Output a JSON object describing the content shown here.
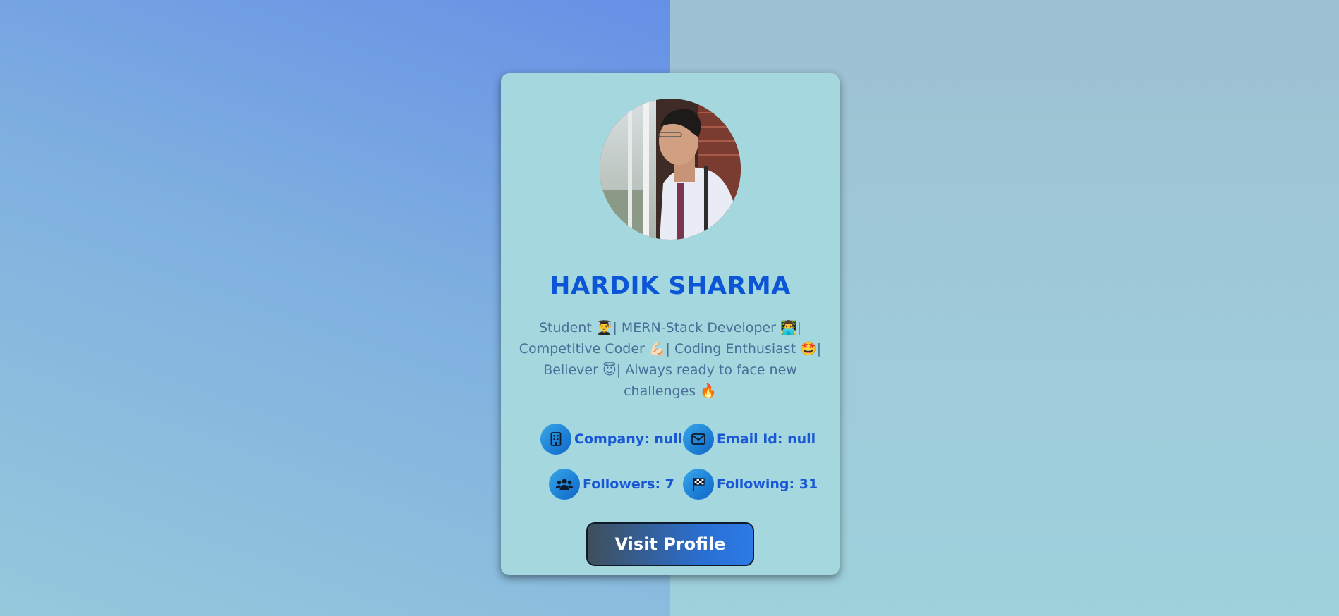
{
  "profile": {
    "name": "HARDIK SHARMA",
    "bio": "Student 👨‍🎓| MERN-Stack Developer 👨‍💻| Competitive Coder 💪🏻| Coding Enthusiast 🤩| Believer 😇| Always ready to face new challenges 🔥"
  },
  "stats": {
    "company": "Company: null",
    "email": "Email Id: null",
    "followers": "Followers: 7",
    "following": "Following: 31"
  },
  "icons": {
    "company": "building-icon",
    "email": "envelope-icon",
    "followers": "users-icon",
    "following": "checkered-flag-icon"
  },
  "actions": {
    "visit_profile": "Visit Profile"
  },
  "colors": {
    "name": "#0b55d6",
    "stat_text": "#1957d4",
    "card_bg": "#a4d8de"
  }
}
